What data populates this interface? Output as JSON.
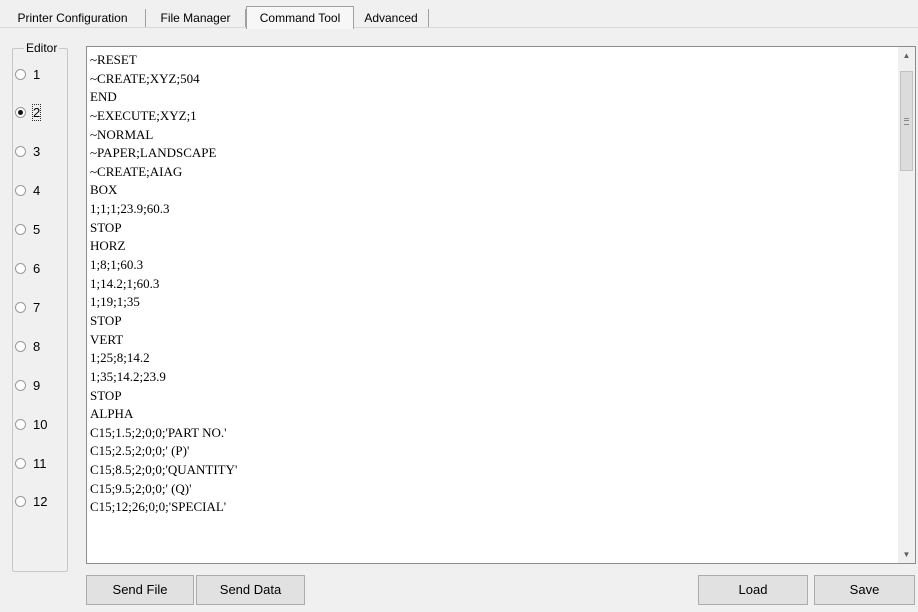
{
  "tabs": [
    {
      "label": "Printer Configuration",
      "active": false
    },
    {
      "label": "File Manager",
      "active": false
    },
    {
      "label": "Command Tool",
      "active": true
    },
    {
      "label": "Advanced",
      "active": false
    }
  ],
  "editor_group": {
    "legend": "Editor",
    "selected": "2",
    "options": [
      "1",
      "2",
      "3",
      "4",
      "5",
      "6",
      "7",
      "8",
      "9",
      "10",
      "11",
      "12"
    ]
  },
  "code_lines": [
    "~RESET",
    "~CREATE;XYZ;504",
    "END",
    "~EXECUTE;XYZ;1",
    "~NORMAL",
    "~PAPER;LANDSCAPE",
    "~CREATE;AIAG",
    "BOX",
    "1;1;1;23.9;60.3",
    "STOP",
    "HORZ",
    "1;8;1;60.3",
    "1;14.2;1;60.3",
    "1;19;1;35",
    "STOP",
    "VERT",
    "1;25;8;14.2",
    "1;35;14.2;23.9",
    "STOP",
    "ALPHA",
    "C15;1.5;2;0;0;'PART NO.'",
    "C15;2.5;2;0;0;' (P)'",
    "C15;8.5;2;0;0;'QUANTITY'",
    "C15;9.5;2;0;0;' (Q)'",
    "C15;12;26;0;0;'SPECIAL'"
  ],
  "buttons": {
    "send_file": "Send File",
    "send_data": "Send Data",
    "load": "Load",
    "save": "Save"
  },
  "icons": {
    "scroll_up": "triangle-up",
    "scroll_down": "triangle-down"
  }
}
